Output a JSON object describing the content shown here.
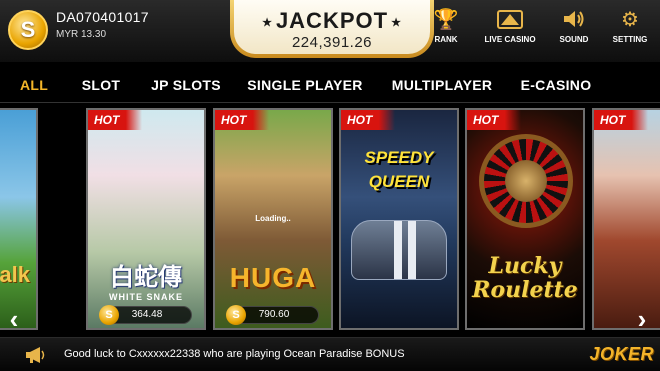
{
  "user": {
    "coin_symbol": "S",
    "id": "DA070401017",
    "balance": "MYR 13.30"
  },
  "jackpot": {
    "title": "JACKPOT",
    "amount": "224,391.26",
    "star": "★"
  },
  "top_icons": [
    {
      "label": "RANK",
      "icon": "trophy-icon",
      "glyph": "🏆"
    },
    {
      "label": "LIVE CASINO",
      "icon": "live-casino-icon",
      "glyph": "▲"
    },
    {
      "label": "SOUND",
      "icon": "speaker-icon",
      "glyph": "🔊"
    },
    {
      "label": "SETTING",
      "icon": "gear-icon",
      "glyph": "⚙"
    }
  ],
  "categories": [
    "ALL",
    "SLOT",
    "JP SLOTS",
    "SINGLE PLAYER",
    "MULTIPLAYER",
    "E-CASINO"
  ],
  "active_category": "ALL",
  "accent_color": "#f4b629",
  "hot_color": "#d8140f",
  "games": [
    {
      "title": "alk",
      "hot": false
    },
    {
      "title": "白蛇傳",
      "subtitle": "WHITE SNAKE",
      "hot": true,
      "hot_label": "HOT",
      "jackpot": "364.48",
      "coin": "S"
    },
    {
      "title": "HUGA",
      "hot": true,
      "hot_label": "HOT",
      "jackpot": "790.60",
      "coin": "S",
      "status": "Loading.."
    },
    {
      "title_line1": "SPEEDY",
      "title_line2": "QUEEN",
      "hot": true,
      "hot_label": "HOT"
    },
    {
      "title_line1": "Lucky",
      "title_line2": "Roulette",
      "hot": true,
      "hot_label": "HOT"
    },
    {
      "title": "",
      "hot": true,
      "hot_label": "HOT"
    }
  ],
  "nav": {
    "prev": "‹",
    "next": "›"
  },
  "marquee": {
    "icon": "megaphone-icon",
    "text": "Good luck to Cxxxxxx22338 who are playing Ocean Paradise BONUS"
  },
  "brand": {
    "logo_text": "JOKER"
  }
}
